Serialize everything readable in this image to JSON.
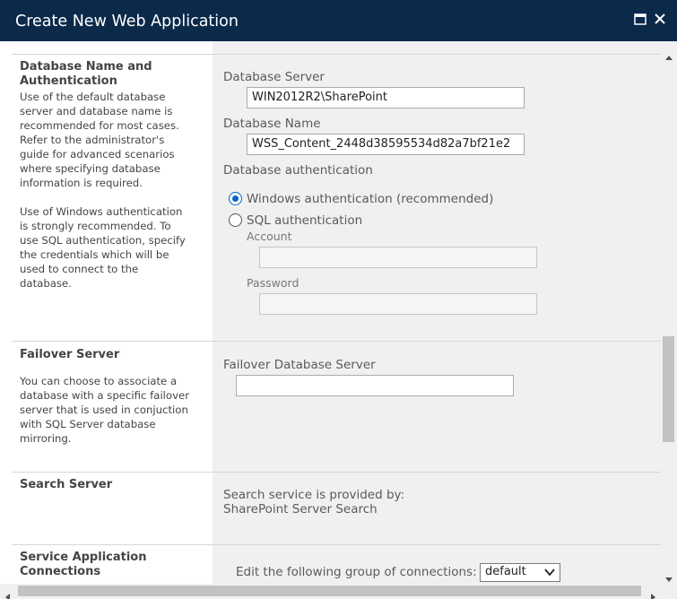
{
  "dialog": {
    "title": "Create New Web Application",
    "maximize_icon": "maximize-icon",
    "close_icon": "close-icon"
  },
  "colors": {
    "titlebar": "#0b2949",
    "right_panel": "#f0f0f0",
    "radio_accent": "#0066cc"
  },
  "database_section": {
    "title": "Database Name and Authentication",
    "description_1": "Use of the default database server and database name is recommended for most cases. Refer to the administrator's guide for advanced scenarios where specifying database information is required.",
    "description_2": "Use of Windows authentication is strongly recommended. To use SQL authentication, specify the credentials which will be used to connect to the database.",
    "server_label": "Database Server",
    "server_value": "WIN2012R2\\SharePoint",
    "name_label": "Database Name",
    "name_value": "WSS_Content_2448d38595534d82a7bf21e2",
    "auth_label": "Database authentication",
    "auth_windows": "Windows authentication (recommended)",
    "auth_sql": "SQL authentication",
    "selected_auth": "Windows authentication (recommended)",
    "account_label": "Account",
    "account_value": "",
    "password_label": "Password",
    "password_value": ""
  },
  "failover_section": {
    "title": "Failover Server",
    "description": "You can choose to associate a database with a specific failover server that is used in conjuction with SQL Server database mirroring.",
    "field_label": "Failover Database Server",
    "field_value": ""
  },
  "search_section": {
    "title": "Search Server",
    "provided_by_label": "Search service is provided by:",
    "provided_by_value": "SharePoint Server Search"
  },
  "service_connections_section": {
    "title": "Service Application Connections",
    "edit_label": "Edit the following group of connections:",
    "group_selected": "default"
  }
}
